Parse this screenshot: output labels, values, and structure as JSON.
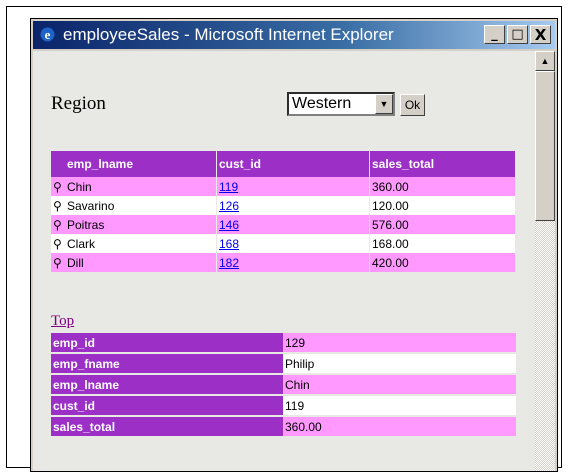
{
  "window": {
    "title": "employeeSales - Microsoft Internet Explorer",
    "minimize": "_",
    "maximize": "□",
    "close": "X"
  },
  "region": {
    "label": "Region",
    "selected": "Western",
    "ok_label": "Ok"
  },
  "sales_table": {
    "headers": [
      "emp_lname",
      "cust_id",
      "sales_total"
    ],
    "rows": [
      {
        "emp_lname": "Chin",
        "cust_id": "119",
        "sales_total": "360.00"
      },
      {
        "emp_lname": "Savarino",
        "cust_id": "126",
        "sales_total": "120.00"
      },
      {
        "emp_lname": "Poitras",
        "cust_id": "146",
        "sales_total": "576.00"
      },
      {
        "emp_lname": "Clark",
        "cust_id": "168",
        "sales_total": "168.00"
      },
      {
        "emp_lname": "Dill",
        "cust_id": "182",
        "sales_total": "420.00"
      }
    ]
  },
  "top_link": "Top",
  "detail": [
    {
      "label": "emp_id",
      "value": "129"
    },
    {
      "label": "emp_fname",
      "value": "Philip"
    },
    {
      "label": "emp_lname",
      "value": "Chin"
    },
    {
      "label": "cust_id",
      "value": "119"
    },
    {
      "label": "sales_total",
      "value": "360.00"
    }
  ],
  "colors": {
    "header_purple": "#9c2fc6",
    "row_pink": "#ff99ff",
    "link_blue": "#0000ee"
  }
}
